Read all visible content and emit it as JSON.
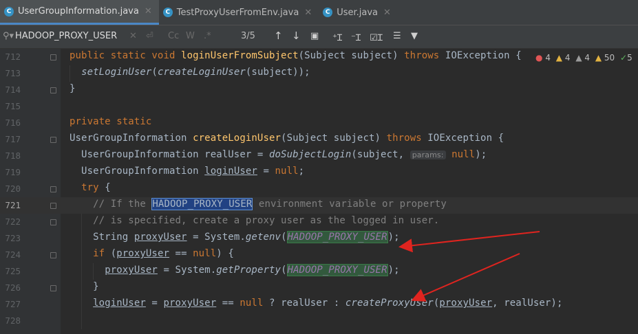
{
  "tabs": [
    {
      "label": "UserGroupInformation.java",
      "active": true
    },
    {
      "label": "TestProxyUserFromEnv.java",
      "active": false
    },
    {
      "label": "User.java",
      "active": false
    }
  ],
  "search": {
    "query": "HADOOP_PROXY_USER",
    "match_count": "3/5",
    "cc": "Cc",
    "w": "W",
    "regex": ".*"
  },
  "inspections": {
    "errors": "4",
    "warnings": "4",
    "weak_warnings": "4",
    "typos": "50",
    "ok": "5"
  },
  "gutter": [
    "712",
    "713",
    "714",
    "715",
    "716",
    "717",
    "718",
    "719",
    "720",
    "721",
    "722",
    "723",
    "724",
    "725",
    "726",
    "727",
    "728"
  ],
  "colors": {
    "keyword": "#cc7832",
    "method_decl": "#ffc66d",
    "comment": "#808080",
    "constant": "#9876aa",
    "arrow": "#e0241f"
  }
}
